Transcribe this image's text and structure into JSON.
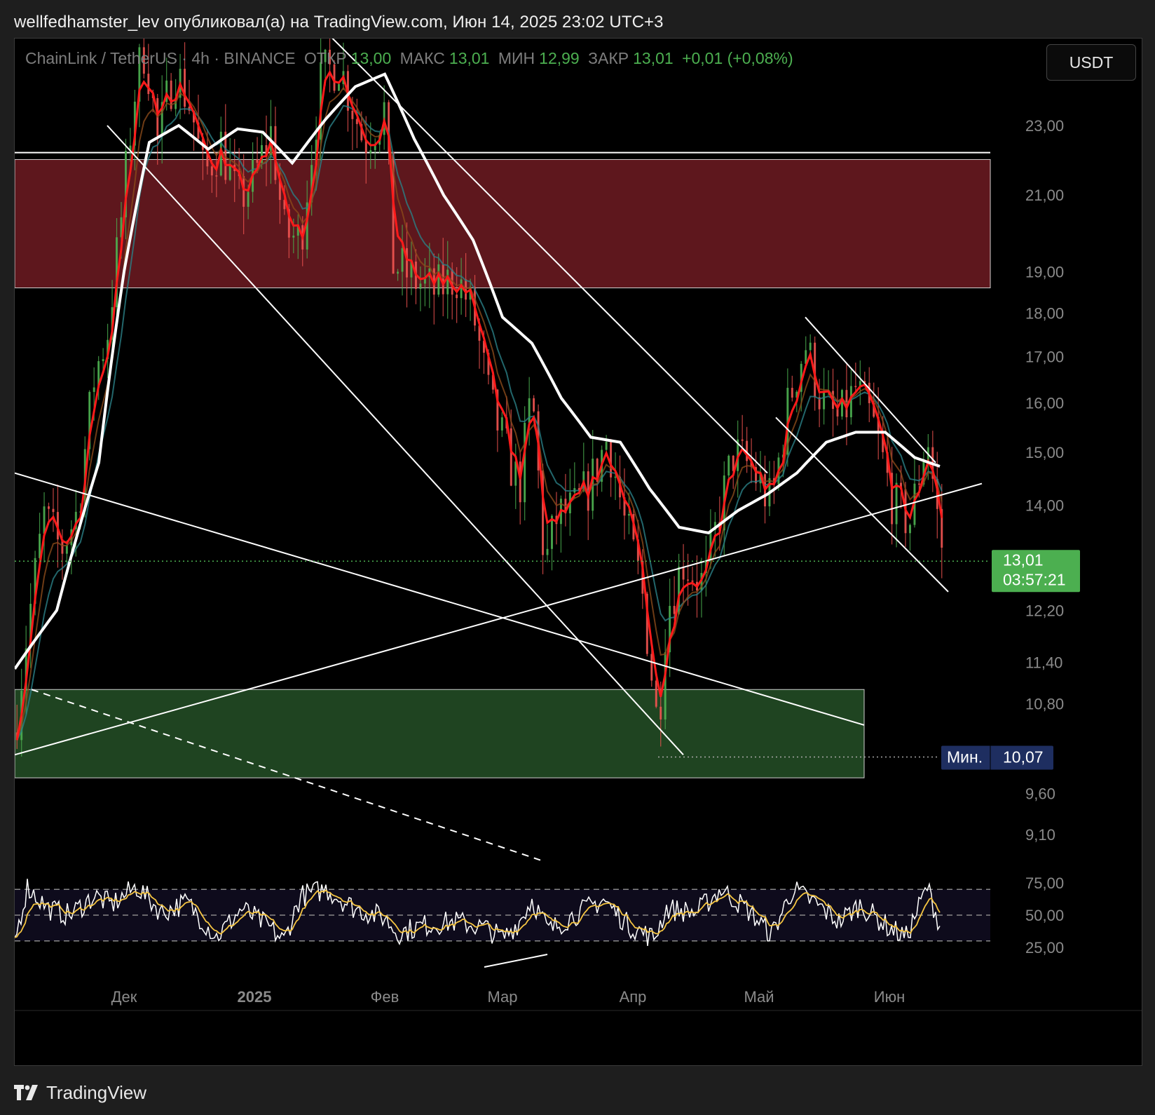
{
  "header": {
    "text": "wellfedhamster_lev опубликовал(а) на TradingView.com, Июн 14, 2025 23:02 UTC+3"
  },
  "legend": {
    "symbol": "ChainLink / TetherUS · 4h · BINANCE",
    "open_label": "ОТКР",
    "open": "13,00",
    "high_label": "МАКС",
    "high": "13,01",
    "low_label": "МИН",
    "low": "12,99",
    "close_label": "ЗАКР",
    "close": "13,01",
    "change": "+0,01 (+0,08%)"
  },
  "currency_button": "USDT",
  "last_price": {
    "value": "13,01",
    "countdown": "03:57:21"
  },
  "min_marker": {
    "label": "Мин.",
    "value": "10,07"
  },
  "footer": {
    "brand": "TradingView"
  },
  "colors": {
    "up": "#4caf50",
    "down": "#ef5350",
    "resistance_zone": "#5e171d",
    "support_zone": "#1f4421",
    "price_badge": "#4caf50",
    "min_badge": "#1e2e60",
    "ema_fast": "#ff1a1a",
    "ma_slow": "#ffffff",
    "rsi_line": "#ffffff",
    "rsi_ma": "#f5c542"
  },
  "chart_data": {
    "type": "candlestick",
    "symbol": "ChainLink / TetherUS",
    "timeframe": "4h",
    "exchange": "BINANCE",
    "price_axis": {
      "scale": "log",
      "range": [
        8.7,
        26.0
      ],
      "ticks": [
        23.0,
        21.0,
        19.0,
        18.0,
        17.0,
        16.0,
        15.0,
        14.0,
        12.2,
        11.4,
        10.8,
        9.6,
        9.1
      ],
      "tick_labels": [
        "23,00",
        "21,00",
        "19,00",
        "18,00",
        "17,00",
        "16,00",
        "15,00",
        "14,00",
        "12,20",
        "11,40",
        "10,80",
        "9,60",
        "9,10"
      ]
    },
    "time_axis": {
      "labels": [
        "Дек",
        "2025",
        "Фев",
        "Мар",
        "Апр",
        "Май",
        "Июн"
      ],
      "dates": [
        "2024-12-01",
        "2025-01-01",
        "2025-02-01",
        "2025-03-01",
        "2025-04-01",
        "2025-05-01",
        "2025-06-01"
      ],
      "range": [
        "2024-11-05",
        "2025-06-14"
      ]
    },
    "approx_close_path": [
      {
        "date": "2024-11-05",
        "price": 10.4
      },
      {
        "date": "2024-11-08",
        "price": 11.9
      },
      {
        "date": "2024-11-12",
        "price": 13.8
      },
      {
        "date": "2024-11-16",
        "price": 13.2
      },
      {
        "date": "2024-11-20",
        "price": 13.9
      },
      {
        "date": "2024-11-24",
        "price": 16.6
      },
      {
        "date": "2024-11-27",
        "price": 17.5
      },
      {
        "date": "2024-11-30",
        "price": 20.0
      },
      {
        "date": "2024-12-04",
        "price": 24.5
      },
      {
        "date": "2024-12-06",
        "price": 25.5
      },
      {
        "date": "2024-12-09",
        "price": 22.5
      },
      {
        "date": "2024-12-13",
        "price": 24.8
      },
      {
        "date": "2024-12-17",
        "price": 23.5
      },
      {
        "date": "2024-12-20",
        "price": 21.5
      },
      {
        "date": "2024-12-24",
        "price": 22.5
      },
      {
        "date": "2024-12-28",
        "price": 20.8
      },
      {
        "date": "2025-01-01",
        "price": 21.5
      },
      {
        "date": "2025-01-05",
        "price": 22.8
      },
      {
        "date": "2025-01-08",
        "price": 20.0
      },
      {
        "date": "2025-01-12",
        "price": 19.8
      },
      {
        "date": "2025-01-17",
        "price": 24.5
      },
      {
        "date": "2025-01-21",
        "price": 25.0
      },
      {
        "date": "2025-01-27",
        "price": 22.5
      },
      {
        "date": "2025-02-01",
        "price": 23.5
      },
      {
        "date": "2025-02-03",
        "price": 19.2
      },
      {
        "date": "2025-02-08",
        "price": 18.8
      },
      {
        "date": "2025-02-13",
        "price": 18.5
      },
      {
        "date": "2025-02-18",
        "price": 18.9
      },
      {
        "date": "2025-02-22",
        "price": 18.0
      },
      {
        "date": "2025-02-26",
        "price": 16.0
      },
      {
        "date": "2025-03-02",
        "price": 15.0
      },
      {
        "date": "2025-03-05",
        "price": 14.3
      },
      {
        "date": "2025-03-08",
        "price": 16.2
      },
      {
        "date": "2025-03-11",
        "price": 12.9
      },
      {
        "date": "2025-03-14",
        "price": 13.8
      },
      {
        "date": "2025-03-18",
        "price": 13.9
      },
      {
        "date": "2025-03-22",
        "price": 14.4
      },
      {
        "date": "2025-03-26",
        "price": 15.3
      },
      {
        "date": "2025-03-30",
        "price": 13.7
      },
      {
        "date": "2025-04-03",
        "price": 12.6
      },
      {
        "date": "2025-04-07",
        "price": 10.4
      },
      {
        "date": "2025-04-09",
        "price": 12.2
      },
      {
        "date": "2025-04-13",
        "price": 13.0
      },
      {
        "date": "2025-04-18",
        "price": 12.6
      },
      {
        "date": "2025-04-22",
        "price": 14.0
      },
      {
        "date": "2025-04-25",
        "price": 15.0
      },
      {
        "date": "2025-04-29",
        "price": 14.7
      },
      {
        "date": "2025-05-04",
        "price": 14.0
      },
      {
        "date": "2025-05-08",
        "price": 16.0
      },
      {
        "date": "2025-05-12",
        "price": 17.3
      },
      {
        "date": "2025-05-16",
        "price": 16.0
      },
      {
        "date": "2025-05-20",
        "price": 15.6
      },
      {
        "date": "2025-05-24",
        "price": 16.3
      },
      {
        "date": "2025-05-28",
        "price": 15.6
      },
      {
        "date": "2025-06-02",
        "price": 14.0
      },
      {
        "date": "2025-06-06",
        "price": 13.7
      },
      {
        "date": "2025-06-10",
        "price": 15.4
      },
      {
        "date": "2025-06-12",
        "price": 14.0
      },
      {
        "date": "2025-06-14",
        "price": 13.01
      }
    ],
    "ma_white_path": [
      {
        "date": "2024-11-05",
        "price": 11.3
      },
      {
        "date": "2024-11-15",
        "price": 12.2
      },
      {
        "date": "2024-11-25",
        "price": 14.8
      },
      {
        "date": "2024-12-01",
        "price": 19.0
      },
      {
        "date": "2024-12-07",
        "price": 22.5
      },
      {
        "date": "2024-12-14",
        "price": 23.0
      },
      {
        "date": "2024-12-21",
        "price": 22.3
      },
      {
        "date": "2024-12-28",
        "price": 22.9
      },
      {
        "date": "2025-01-03",
        "price": 22.8
      },
      {
        "date": "2025-01-10",
        "price": 21.9
      },
      {
        "date": "2025-01-18",
        "price": 23.2
      },
      {
        "date": "2025-01-25",
        "price": 24.2
      },
      {
        "date": "2025-02-01",
        "price": 24.6
      },
      {
        "date": "2025-02-08",
        "price": 22.6
      },
      {
        "date": "2025-02-15",
        "price": 21.0
      },
      {
        "date": "2025-02-22",
        "price": 19.8
      },
      {
        "date": "2025-03-01",
        "price": 17.9
      },
      {
        "date": "2025-03-08",
        "price": 17.3
      },
      {
        "date": "2025-03-15",
        "price": 16.1
      },
      {
        "date": "2025-03-22",
        "price": 15.3
      },
      {
        "date": "2025-03-29",
        "price": 15.2
      },
      {
        "date": "2025-04-05",
        "price": 14.3
      },
      {
        "date": "2025-04-12",
        "price": 13.6
      },
      {
        "date": "2025-04-19",
        "price": 13.5
      },
      {
        "date": "2025-04-26",
        "price": 13.9
      },
      {
        "date": "2025-05-03",
        "price": 14.2
      },
      {
        "date": "2025-05-10",
        "price": 14.6
      },
      {
        "date": "2025-05-17",
        "price": 15.2
      },
      {
        "date": "2025-05-24",
        "price": 15.4
      },
      {
        "date": "2025-05-31",
        "price": 15.4
      },
      {
        "date": "2025-06-07",
        "price": 14.9
      },
      {
        "date": "2025-06-14",
        "price": 14.7
      }
    ],
    "zones": [
      {
        "name": "resistance",
        "price_from": 18.6,
        "price_to": 22.0,
        "date_from": "2024-11-05",
        "date_to": "2025-06-14"
      },
      {
        "name": "support",
        "price_from": 9.8,
        "price_to": 11.0,
        "date_from": "2024-11-05",
        "date_to": "2025-05-26"
      }
    ],
    "horizontal_lines": [
      22.2
    ],
    "trendlines": [
      {
        "from": {
          "date": "2024-11-27",
          "price": 23.0
        },
        "to": {
          "date": "2025-04-13",
          "price": 10.1
        }
      },
      {
        "from": {
          "date": "2024-11-05",
          "price": 14.6
        },
        "to": {
          "date": "2025-05-26",
          "price": 10.5
        }
      },
      {
        "from": {
          "date": "2024-11-05",
          "price": 10.1
        },
        "to": {
          "date": "2025-06-23",
          "price": 14.4
        }
      },
      {
        "from": {
          "date": "2025-01-18",
          "price": 26.0
        },
        "to": {
          "date": "2025-05-03",
          "price": 14.6
        }
      },
      {
        "from": {
          "date": "2025-05-12",
          "price": 17.9
        },
        "to": {
          "date": "2025-06-12",
          "price": 14.8
        }
      },
      {
        "from": {
          "date": "2025-05-05",
          "price": 15.7
        },
        "to": {
          "date": "2025-06-15",
          "price": 12.5
        }
      }
    ],
    "dashed_trendline": {
      "from": {
        "date": "2024-11-09",
        "price": 11.0
      },
      "to": {
        "date": "2025-03-10",
        "price": 8.8
      }
    },
    "last_price": 13.01,
    "period_min": 10.07,
    "rsi": {
      "ticks": [
        75,
        50,
        25
      ],
      "tick_labels": [
        "75,00",
        "50,00",
        "25,00"
      ],
      "band_upper": 70,
      "band_middle": 50,
      "band_lower": 30,
      "approx_path": [
        {
          "date": "2024-11-05",
          "value": 30
        },
        {
          "date": "2024-11-08",
          "value": 72
        },
        {
          "date": "2024-11-13",
          "value": 55
        },
        {
          "date": "2024-11-18",
          "value": 50
        },
        {
          "date": "2024-11-24",
          "value": 65
        },
        {
          "date": "2024-11-28",
          "value": 58
        },
        {
          "date": "2024-12-04",
          "value": 72
        },
        {
          "date": "2024-12-10",
          "value": 52
        },
        {
          "date": "2024-12-16",
          "value": 60
        },
        {
          "date": "2024-12-23",
          "value": 33
        },
        {
          "date": "2024-12-29",
          "value": 55
        },
        {
          "date": "2025-01-04",
          "value": 42
        },
        {
          "date": "2025-01-08",
          "value": 30
        },
        {
          "date": "2025-01-12",
          "value": 65
        },
        {
          "date": "2025-01-18",
          "value": 70
        },
        {
          "date": "2025-01-25",
          "value": 55
        },
        {
          "date": "2025-02-01",
          "value": 48
        },
        {
          "date": "2025-02-04",
          "value": 36
        },
        {
          "date": "2025-02-10",
          "value": 42
        },
        {
          "date": "2025-02-18",
          "value": 45
        },
        {
          "date": "2025-02-25",
          "value": 40
        },
        {
          "date": "2025-03-01",
          "value": 32
        },
        {
          "date": "2025-03-05",
          "value": 45
        },
        {
          "date": "2025-03-08",
          "value": 62
        },
        {
          "date": "2025-03-12",
          "value": 38
        },
        {
          "date": "2025-03-18",
          "value": 50
        },
        {
          "date": "2025-03-25",
          "value": 62
        },
        {
          "date": "2025-03-31",
          "value": 42
        },
        {
          "date": "2025-04-06",
          "value": 32
        },
        {
          "date": "2025-04-09",
          "value": 55
        },
        {
          "date": "2025-04-16",
          "value": 52
        },
        {
          "date": "2025-04-22",
          "value": 70
        },
        {
          "date": "2025-04-28",
          "value": 55
        },
        {
          "date": "2025-05-04",
          "value": 35
        },
        {
          "date": "2025-05-09",
          "value": 70
        },
        {
          "date": "2025-05-14",
          "value": 60
        },
        {
          "date": "2025-05-20",
          "value": 45
        },
        {
          "date": "2025-05-25",
          "value": 58
        },
        {
          "date": "2025-06-01",
          "value": 40
        },
        {
          "date": "2025-06-05",
          "value": 33
        },
        {
          "date": "2025-06-10",
          "value": 72
        },
        {
          "date": "2025-06-14",
          "value": 32
        }
      ]
    }
  }
}
